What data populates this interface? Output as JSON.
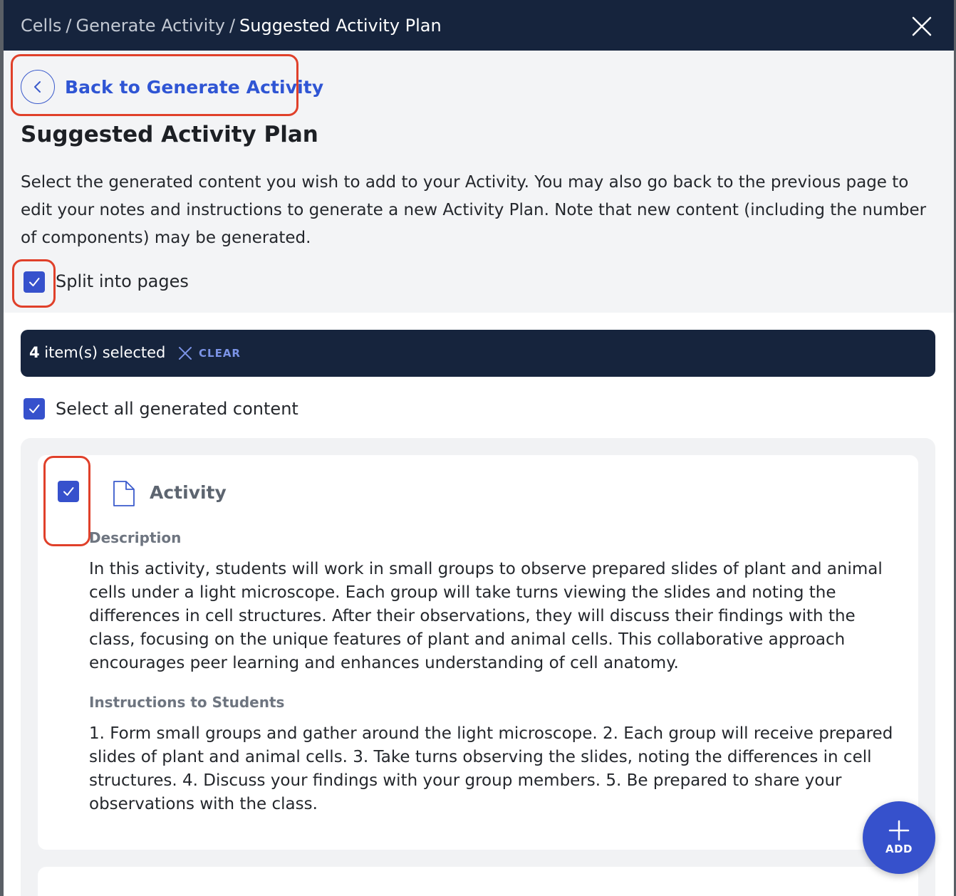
{
  "breadcrumb": {
    "items": [
      "Cells",
      "Generate Activity",
      "Suggested Activity Plan"
    ]
  },
  "header": {
    "back_label": "Back to Generate Activity",
    "title": "Suggested Activity Plan",
    "intro": "Select the generated content you wish to add to your Activity. You may also go back to the previous page to edit your notes and instructions to generate a new Activity Plan. Note that new content (including the number of components) may be generated.",
    "split_label": "Split into pages"
  },
  "selection": {
    "count": "4",
    "count_suffix": " item(s) selected",
    "clear_label": "CLEAR",
    "select_all_label": "Select all generated content"
  },
  "card": {
    "title": "Activity",
    "description_label": "Description",
    "description": "In this activity, students will work in small groups to observe prepared slides of plant and animal cells under a light microscope. Each group will take turns viewing the slides and noting the differences in cell structures. After their observations, they will discuss their findings with the class, focusing on the unique features of plant and animal cells. This collaborative approach encourages peer learning and enhances understanding of cell anatomy.",
    "instructions_label": "Instructions to Students",
    "instructions": "1. Form small groups and gather around the light microscope. 2. Each group will receive prepared slides of plant and animal cells. 3. Take turns observing the slides, noting the differences in cell structures. 4. Discuss your findings with your group members. 5. Be prepared to share your observations with the class."
  },
  "fab": {
    "label": "ADD"
  },
  "colors": {
    "topbar": "#16243d",
    "accent": "#3651cc",
    "link": "#2f55d4",
    "highlight": "#e0402a"
  },
  "icons": [
    "close-icon",
    "chevron-left-icon",
    "check-icon",
    "document-icon",
    "plus-icon"
  ]
}
